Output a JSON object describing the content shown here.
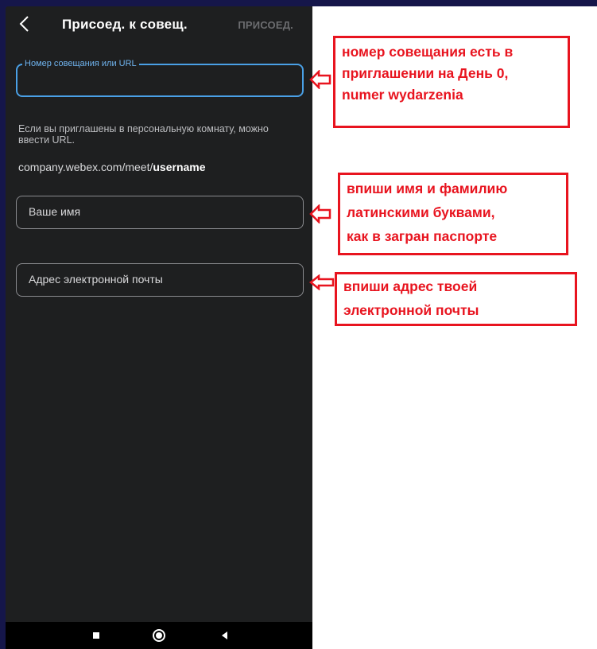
{
  "header": {
    "title": "Присоед. к совещ.",
    "join_label": "ПРИСОЕД."
  },
  "form": {
    "meeting_field": {
      "label": "Номер совещания или URL",
      "value": ""
    },
    "hint": "Если вы приглашены в персональную комнату, можно ввести URL.",
    "url_example": {
      "prefix": "company.webex.com/meet/",
      "username": "username"
    },
    "name_field": {
      "placeholder": "Ваше имя"
    },
    "email_field": {
      "placeholder": "Адрес электронной почты"
    }
  },
  "annotations": [
    {
      "lines": [
        "номер совещания есть в",
        "приглашении на День 0,",
        "numer wydarzenia"
      ]
    },
    {
      "lines": [
        "впиши имя и фамилию",
        "латинскими буквами,",
        "как в загран паспорте"
      ]
    },
    {
      "lines": [
        "впиши адрес твоей",
        "электронной почты"
      ]
    }
  ],
  "colors": {
    "annotation_red": "#e8141f",
    "focus_blue": "#4aa0e6",
    "app_background": "#1e1f20"
  }
}
